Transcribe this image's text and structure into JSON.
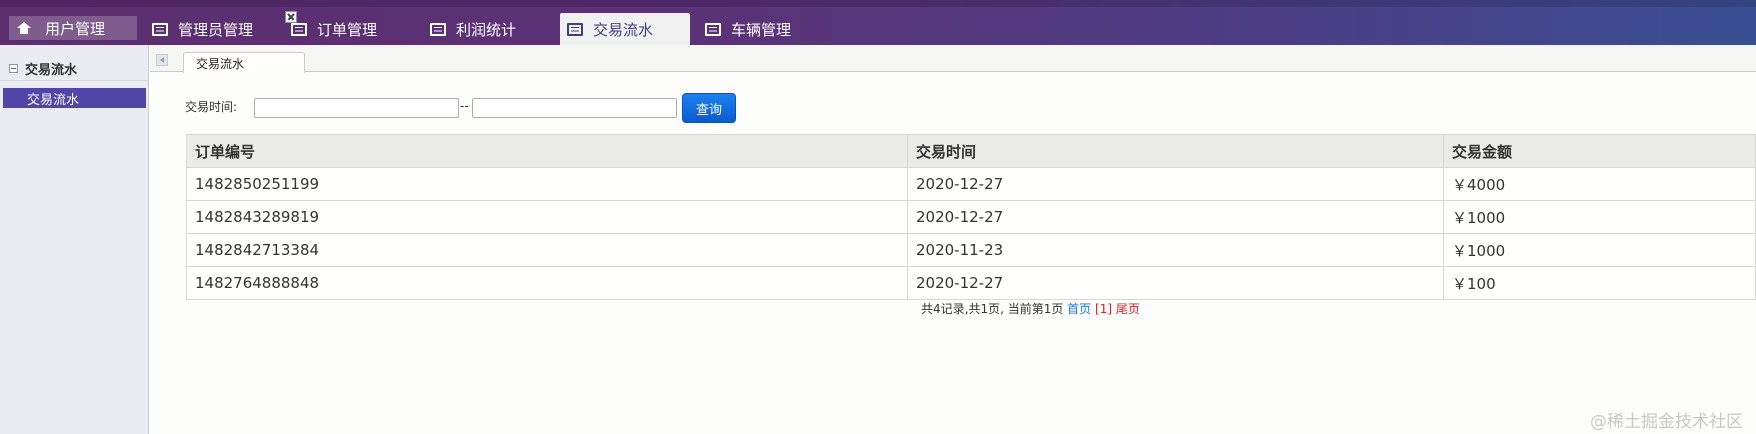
{
  "nav": {
    "tabs": [
      {
        "label": "用户管理",
        "icon": "home-icon"
      },
      {
        "label": "管理员管理",
        "icon": "list-icon"
      },
      {
        "label": "订单管理",
        "icon": "list-icon"
      },
      {
        "label": "利润统计",
        "icon": "list-icon"
      },
      {
        "label": "交易流水",
        "icon": "list-icon",
        "active": true
      },
      {
        "label": "车辆管理",
        "icon": "list-icon"
      }
    ]
  },
  "sidebar": {
    "header": "交易流水",
    "items": [
      {
        "label": "交易流水",
        "selected": true
      }
    ]
  },
  "content_tab": {
    "label": "交易流水"
  },
  "filter": {
    "label": "交易时间:",
    "start_value": "",
    "separator": "--",
    "end_value": "",
    "query_label": "查询"
  },
  "table": {
    "columns": [
      "订单编号",
      "交易时间",
      "交易金额"
    ],
    "rows": [
      [
        "1482850251199",
        "2020-12-27",
        "￥4000"
      ],
      [
        "1482843289819",
        "2020-12-27",
        "￥1000"
      ],
      [
        "1482842713384",
        "2020-11-23",
        "￥1000"
      ],
      [
        "1482764888848",
        "2020-12-27",
        "￥100"
      ]
    ]
  },
  "pager": {
    "summary": "共4记录,共1页, 当前第1页 ",
    "first": "首页",
    "current": "[1]",
    "last": "尾页"
  },
  "watermark": "@稀土掘金技术社区",
  "colors": {
    "accent": "#5046a8",
    "query_button": "#1a6fe0",
    "pager_link": "#1a73d8",
    "pager_current": "#e02020"
  }
}
